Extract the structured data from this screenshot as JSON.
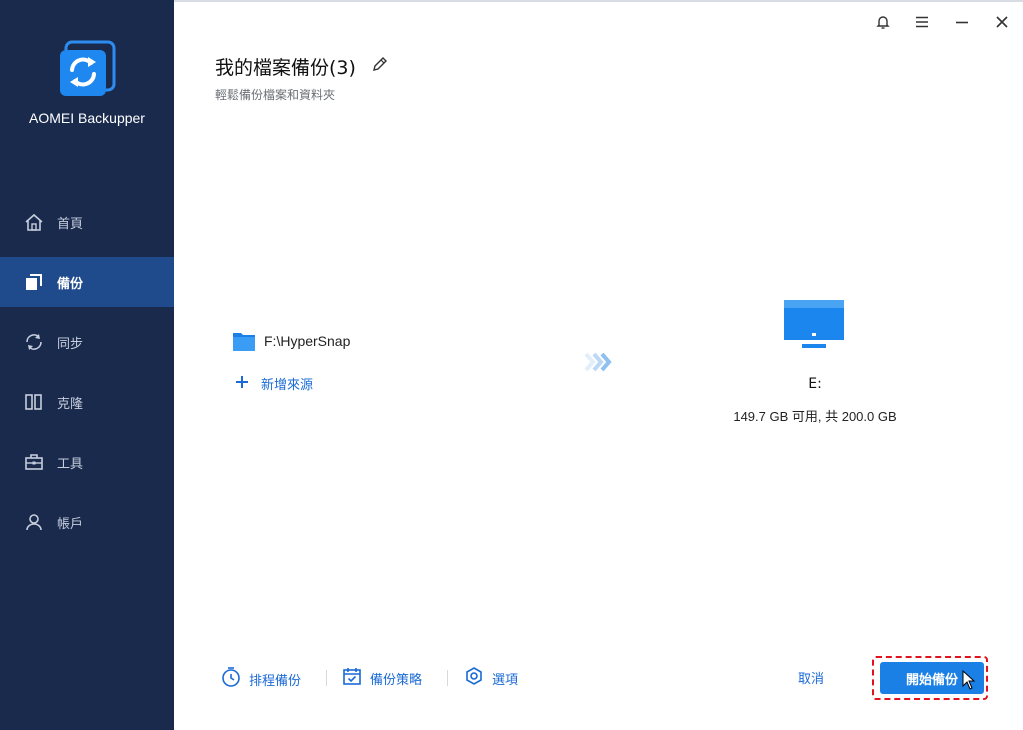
{
  "app": {
    "name": "AOMEI Backupper"
  },
  "sidebar": {
    "items": [
      {
        "label": "首頁",
        "icon": "home-icon",
        "active": false
      },
      {
        "label": "備份",
        "icon": "backup-icon",
        "active": true
      },
      {
        "label": "同步",
        "icon": "sync-icon",
        "active": false
      },
      {
        "label": "克隆",
        "icon": "clone-icon",
        "active": false
      },
      {
        "label": "工具",
        "icon": "toolbox-icon",
        "active": false
      },
      {
        "label": "帳戶",
        "icon": "user-icon",
        "active": false
      }
    ]
  },
  "window_controls": [
    "bell-icon",
    "menu-icon",
    "minimize-icon",
    "close-icon"
  ],
  "header": {
    "title": "我的檔案備份(3)",
    "subtitle": "輕鬆備份檔案和資料夾"
  },
  "source": {
    "path": "F:\\HyperSnap",
    "add_label": "新增來源"
  },
  "destination": {
    "drive": "E:",
    "space": "149.7 GB 可用, 共 200.0 GB"
  },
  "footer": {
    "schedule_label": "排程備份",
    "scheme_label": "備份策略",
    "options_label": "選項",
    "cancel_label": "取消",
    "start_label": "開始備份"
  },
  "colors": {
    "sidebar_bg": "#1a2a4d",
    "sidebar_active": "#1f4a8c",
    "accent": "#1a80e5",
    "link": "#1a6ad6",
    "highlight": "#e0121e"
  }
}
